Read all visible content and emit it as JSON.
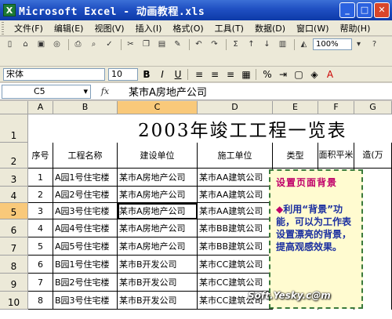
{
  "window": {
    "title": "Microsoft Excel - 动画教程.xls",
    "app_icon_letter": "X"
  },
  "menu": [
    "文件(F)",
    "编辑(E)",
    "视图(V)",
    "插入(I)",
    "格式(O)",
    "工具(T)",
    "数据(D)",
    "窗口(W)",
    "帮助(H)"
  ],
  "toolbar": {
    "zoom": "100%"
  },
  "format_bar": {
    "font": "宋体",
    "size": "10"
  },
  "formula_bar": {
    "name_box": "C5",
    "fx": "fx",
    "value": "某市A房地产公司"
  },
  "grid": {
    "columns": [
      "A",
      "B",
      "C",
      "D",
      "E",
      "F",
      "G"
    ],
    "rows": [
      "1",
      "2",
      "3",
      "4",
      "5",
      "6",
      "7",
      "8",
      "9",
      "10"
    ],
    "title": "2003年竣工工程一览表",
    "headers": [
      "序号",
      "工程名称",
      "建设单位",
      "施工单位",
      "类型",
      "面积平米",
      "造(万"
    ],
    "data": [
      [
        "1",
        "A园1号住宅楼",
        "某市A房地产公司",
        "某市AA建筑公司"
      ],
      [
        "2",
        "A园2号住宅楼",
        "某市A房地产公司",
        "某市AA建筑公司"
      ],
      [
        "3",
        "A园3号住宅楼",
        "某市A房地产公司",
        "某市AA建筑公司"
      ],
      [
        "4",
        "A园4号住宅楼",
        "某市A房地产公司",
        "某市BB建筑公司"
      ],
      [
        "5",
        "A园5号住宅楼",
        "某市A房地产公司",
        "某市BB建筑公司"
      ],
      [
        "6",
        "B园1号住宅楼",
        "某市B开发公司",
        "某市CC建筑公司"
      ],
      [
        "7",
        "B园2号住宅楼",
        "某市B开发公司",
        "某市CC建筑公司"
      ],
      [
        "8",
        "B园3号住宅楼",
        "某市B开发公司",
        "某市CC建筑公司"
      ]
    ]
  },
  "note": {
    "title": "设置页面背景",
    "bullet": "◆",
    "body": "利用“背景”功能，可以为工作表设置漂亮的背景，提高观感效果。"
  },
  "watermark": "Soft.Yesky.c@m"
}
